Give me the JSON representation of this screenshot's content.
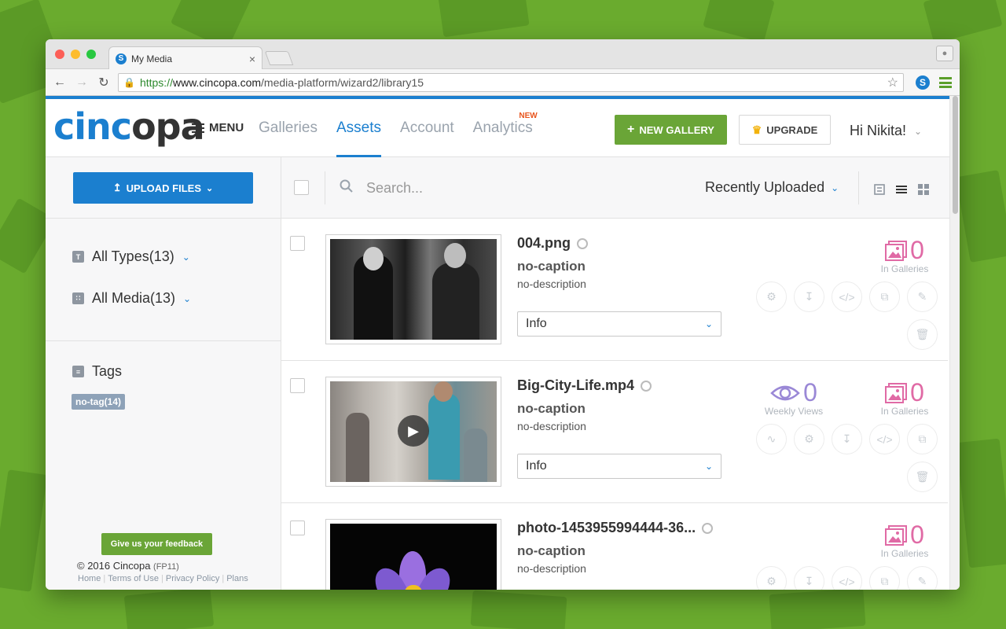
{
  "browser": {
    "tab_title": "My Media",
    "tab_close": "×",
    "url_scheme": "https://",
    "url_host": "www.cincopa.com",
    "url_path": "/media-platform/wizard2/library15"
  },
  "colors": {
    "brand_blue": "#1b7fcf",
    "brand_green": "#6aa537",
    "stat_pink": "#e06aa5",
    "stat_purple": "#9a88d6"
  },
  "header": {
    "logo_part1": "cinc",
    "logo_part2": "opa",
    "menu_label": "MENU",
    "nav": [
      {
        "label": "Galleries"
      },
      {
        "label": "Assets"
      },
      {
        "label": "Account"
      },
      {
        "label": "Analytics",
        "badge": "NEW"
      }
    ],
    "new_gallery": "NEW GALLERY",
    "upgrade": "UPGRADE",
    "greeting": "Hi Nikita!"
  },
  "sidebar": {
    "upload_label": "UPLOAD FILES",
    "filter_types": "All Types(13)",
    "filter_media": "All Media(13)",
    "tags_title": "Tags",
    "tag_chip": "no-tag(14)",
    "feedback": "Give us your feedback",
    "copyright": "© 2016 Cincopa",
    "version": "(FP11)",
    "footer_links": [
      "Home",
      "Terms of Use",
      "Privacy Policy",
      "Plans"
    ]
  },
  "toolbar": {
    "search_placeholder": "Search...",
    "sort_label": "Recently Uploaded"
  },
  "assets": [
    {
      "title": "004.png",
      "caption": "no-caption",
      "description": "no-description",
      "info": "Info",
      "galleries_count": "0",
      "galleries_label": "In Galleries"
    },
    {
      "title": "Big-City-Life.mp4",
      "caption": "no-caption",
      "description": "no-description",
      "info": "Info",
      "views_count": "0",
      "views_label": "Weekly Views",
      "galleries_count": "0",
      "galleries_label": "In Galleries"
    },
    {
      "title": "photo-1453955994444-36...",
      "caption": "no-caption",
      "description": "no-description",
      "galleries_count": "0",
      "galleries_label": "In Galleries"
    }
  ]
}
